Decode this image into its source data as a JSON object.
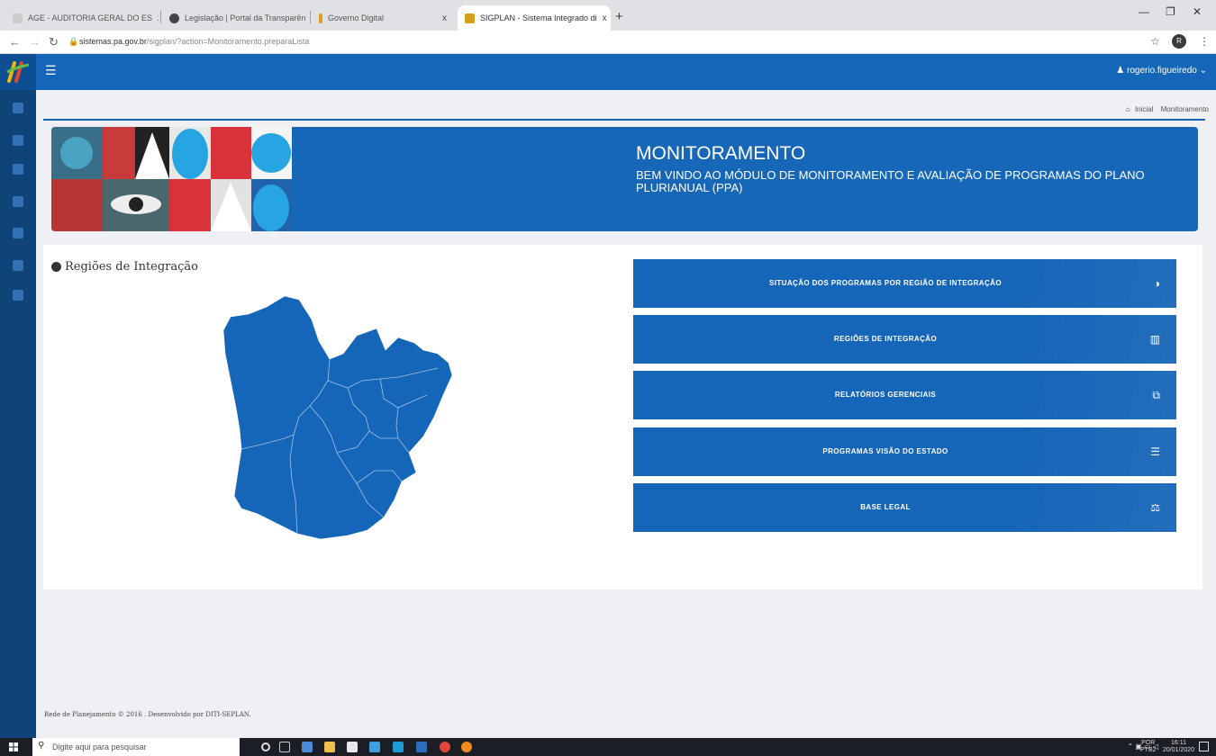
{
  "browser": {
    "tabs": [
      {
        "label": "AGE - AUDITORIA GERAL DO ES",
        "favicon_color": "#cccccc"
      },
      {
        "label": "Legislação | Portal da Transparên",
        "favicon_color": "#444444"
      },
      {
        "label": "Governo Digital",
        "favicon_color": "#e0a020"
      },
      {
        "label": "SIGPLAN - Sistema Integrado di",
        "favicon_color": "#d4a017"
      }
    ],
    "tab_close": "x",
    "new_tab": "+",
    "url_host": "sistemas.pa.gov.br",
    "url_path": "/sigplan/?action=Monitoramento.preparaLista",
    "profile_initial": "R"
  },
  "app": {
    "user_name": "rogerio.figueiredo",
    "breadcrumb": {
      "home": "Inicial",
      "current": "Monitoramento"
    },
    "banner": {
      "title": "MONITORAMENTO",
      "subtitle": "BEM VINDO AO MÓDULO DE MONITORAMENTO E AVALIAÇÃO DE PROGRAMAS DO PLANO PLURIANUAL (PPA)"
    },
    "map_title": "Regiões de Integração",
    "menu": [
      {
        "label": "SITUAÇÃO DOS PROGRAMAS POR REGIÃO DE INTEGRAÇÃO",
        "icon": "adjust-icon",
        "glyph": "◑"
      },
      {
        "label": "REGIÕES DE INTEGRAÇÃO",
        "icon": "map-icon",
        "glyph": "▥"
      },
      {
        "label": "RELATÓRIOS GERENCIAIS",
        "icon": "copy-icon",
        "glyph": "⧉"
      },
      {
        "label": "PROGRAMAS VISÃO DO ESTADO",
        "icon": "list-icon",
        "glyph": "☰"
      },
      {
        "label": "BASE LEGAL",
        "icon": "balance-scale-icon",
        "glyph": "⚖"
      }
    ],
    "footer": "Rede de Planejamento © 2016 . Desenvolvido por DITI-SEPLAN.",
    "colors": {
      "primary": "#1565b8",
      "sidebar": "#0e4477"
    }
  },
  "taskbar": {
    "search_placeholder": "Digite aqui para pesquisar",
    "lang_top": "POR",
    "lang_bottom": "PTB2",
    "time": "16:11",
    "date": "20/01/2020"
  }
}
